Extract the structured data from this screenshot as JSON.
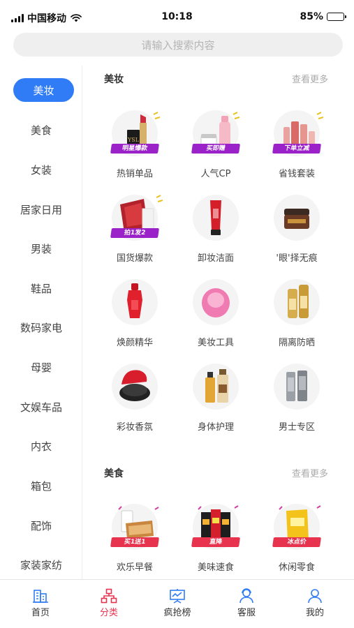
{
  "status_bar": {
    "carrier": "中国移动",
    "time": "10:18",
    "battery": "85%",
    "battery_level": 0.85
  },
  "search": {
    "placeholder": "请输入搜索内容"
  },
  "sidebar": {
    "items": [
      {
        "label": "美妆",
        "active": true
      },
      {
        "label": "美食"
      },
      {
        "label": "女装"
      },
      {
        "label": "居家日用"
      },
      {
        "label": "男装"
      },
      {
        "label": "鞋品"
      },
      {
        "label": "数码家电"
      },
      {
        "label": "母婴"
      },
      {
        "label": "文娱车品"
      },
      {
        "label": "内衣"
      },
      {
        "label": "箱包"
      },
      {
        "label": "配饰"
      },
      {
        "label": "家装家纺"
      }
    ]
  },
  "sections": [
    {
      "title": "美妆",
      "more": "查看更多",
      "items": [
        {
          "label": "热销单品",
          "tag": "明星爆款",
          "icon": "lipstick-icon"
        },
        {
          "label": "人气CP",
          "tag": "买即赠",
          "icon": "cosmetics-set-icon"
        },
        {
          "label": "省钱套装",
          "tag": "下单立减",
          "icon": "skincare-bottles-icon"
        },
        {
          "label": "国货爆款",
          "tag": "拍1发2",
          "icon": "face-mask-icon"
        },
        {
          "label": "卸妆洁面",
          "icon": "cleanser-tube-icon"
        },
        {
          "label": "'眼'择无痕",
          "icon": "eye-cream-jar-icon"
        },
        {
          "label": "焕颜精华",
          "icon": "serum-bottle-icon"
        },
        {
          "label": "美妆工具",
          "icon": "cleansing-brush-icon"
        },
        {
          "label": "隔离防晒",
          "icon": "sunscreen-icon"
        },
        {
          "label": "彩妆香氛",
          "icon": "cushion-compact-icon"
        },
        {
          "label": "身体护理",
          "icon": "body-care-icon"
        },
        {
          "label": "男士专区",
          "icon": "mens-care-icon"
        }
      ]
    },
    {
      "title": "美食",
      "more": "查看更多",
      "items": [
        {
          "label": "欢乐早餐",
          "tag": "买1送1",
          "icon": "breakfast-bread-icon"
        },
        {
          "label": "美味速食",
          "tag": "直降",
          "icon": "instant-noodles-icon"
        },
        {
          "label": "休闲零食",
          "tag": "冰点价",
          "icon": "snack-bag-icon"
        }
      ]
    }
  ],
  "tabbar": {
    "items": [
      {
        "label": "首页",
        "icon": "building-icon"
      },
      {
        "label": "分类",
        "icon": "category-tree-icon",
        "active": true
      },
      {
        "label": "疯抢榜",
        "icon": "ranking-board-icon"
      },
      {
        "label": "客服",
        "icon": "customer-service-icon"
      },
      {
        "label": "我的",
        "icon": "profile-icon"
      }
    ]
  },
  "colors": {
    "accent": "#2f7cf6",
    "active_tab": "#e8334f",
    "tag_purple": "#9b22c9",
    "tag_red": "#e8334f"
  }
}
